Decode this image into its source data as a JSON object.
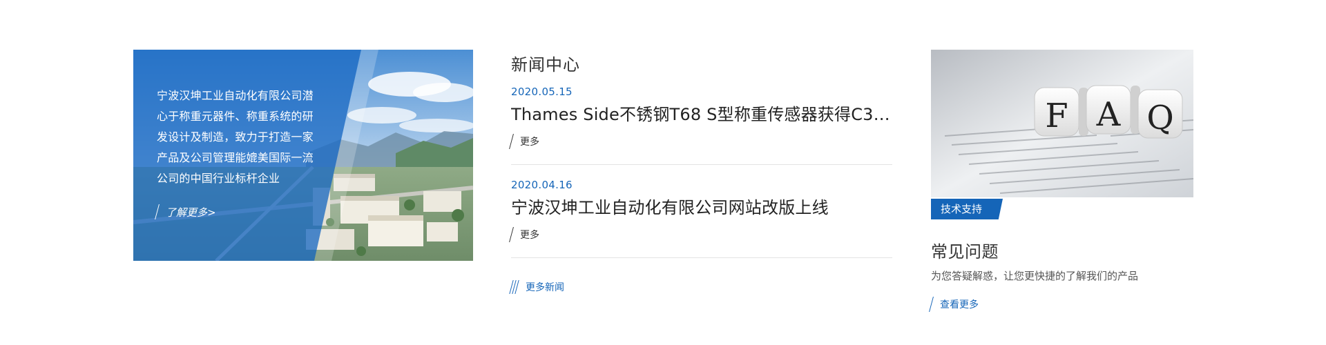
{
  "intro": {
    "description": "宁波汉坤工业自动化有限公司潜心于称重元器件、称重系统的研发设计及制造，致力于打造一家产品及公司管理能媲美国际一流公司的中国行业标杆企业",
    "more_label": "了解更多>"
  },
  "news": {
    "section_title": "新闻中心",
    "items": [
      {
        "date": "2020.05.15",
        "title": "Thames Side不锈钢T68 S型称重传感器获得C3认证",
        "more_label": "更多"
      },
      {
        "date": "2020.04.16",
        "title": "宁波汉坤工业自动化有限公司网站改版上线",
        "more_label": "更多"
      }
    ],
    "more_news_label": "更多新闻"
  },
  "faq": {
    "image_text": "FAQ",
    "tag": "技术支持",
    "title": "常见问题",
    "description": "为您答疑解惑，让您更快捷的了解我们的产品",
    "more_label": "查看更多"
  },
  "colors": {
    "accent": "#1565b8",
    "overlay": "#1e6cc4",
    "divider": "#e3e3e3"
  }
}
